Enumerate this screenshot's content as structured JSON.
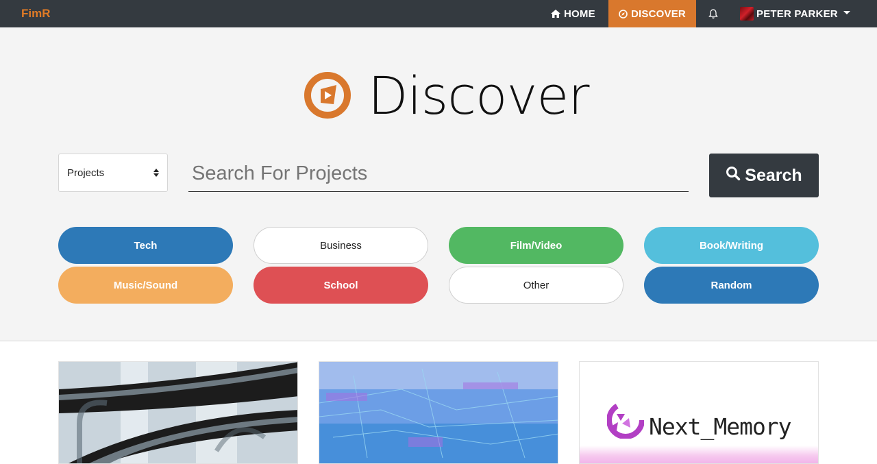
{
  "nav": {
    "brand": "FimR",
    "home_label": "HOME",
    "discover_label": "DISCOVER",
    "user_name": "PETER PARKER",
    "icons": [
      "home-icon",
      "compass-icon",
      "bell-icon",
      "avatar",
      "caret-down-icon"
    ],
    "accent": "#d9782d"
  },
  "hero": {
    "title": "Discover",
    "logo_icon": "play-circle-icon",
    "select_value": "Projects",
    "search_placeholder": "Search For Projects",
    "search_button": "Search"
  },
  "categories": [
    {
      "label": "Tech",
      "color": "#2d79b7"
    },
    {
      "label": "Business",
      "color": "#ffffff"
    },
    {
      "label": "Film/Video",
      "color": "#52b862"
    },
    {
      "label": "Book/Writing",
      "color": "#54bfdc"
    },
    {
      "label": "Music/Sound",
      "color": "#f3ad5e"
    },
    {
      "label": "School",
      "color": "#de5054"
    },
    {
      "label": "Other",
      "color": "#ffffff"
    },
    {
      "label": "Random",
      "color": "#2d79b7"
    }
  ],
  "cards": {
    "third_card_text": "Next_Memory"
  }
}
